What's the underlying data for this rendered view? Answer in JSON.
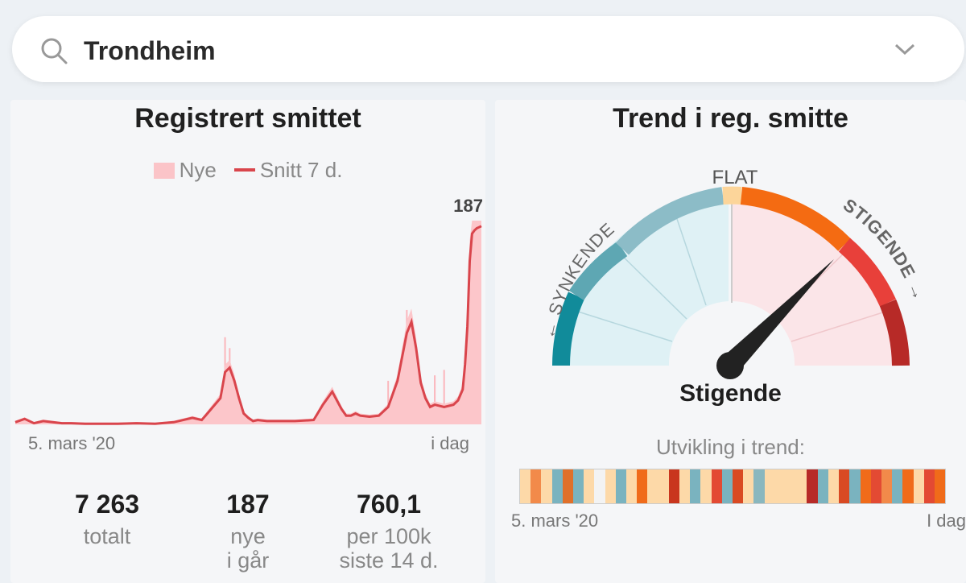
{
  "search": {
    "value": "Trondheim",
    "icon": "search-icon",
    "dropdown_icon": "chevron-down-icon"
  },
  "cases_card": {
    "title": "Registrert smittet",
    "legend": {
      "new_label": "Nye",
      "avg_label": "Snitt 7 d."
    },
    "peak_label": "187",
    "x_start": "5. mars '20",
    "x_end": "i dag",
    "stats": [
      {
        "value": "7 263",
        "label1": "totalt",
        "label2": ""
      },
      {
        "value": "187",
        "label1": "nye",
        "label2": "i går"
      },
      {
        "value": "760,1",
        "label1": "per 100k",
        "label2": "siste 14 d."
      }
    ]
  },
  "chart_data": {
    "type": "area",
    "title": "Registrert smittet",
    "xlabel": "",
    "ylabel": "",
    "x_range": [
      "5. mars '20",
      "i dag"
    ],
    "ylim": [
      0,
      187
    ],
    "legend": [
      "Nye",
      "Snitt 7 d."
    ],
    "annotation": "187",
    "series": [
      {
        "name": "Snitt 7 d.",
        "x_fraction": [
          0,
          0.02,
          0.04,
          0.06,
          0.08,
          0.1,
          0.12,
          0.15,
          0.18,
          0.22,
          0.26,
          0.3,
          0.34,
          0.38,
          0.4,
          0.42,
          0.44,
          0.45,
          0.46,
          0.47,
          0.48,
          0.49,
          0.5,
          0.51,
          0.52,
          0.54,
          0.56,
          0.6,
          0.64,
          0.66,
          0.68,
          0.7,
          0.71,
          0.72,
          0.73,
          0.74,
          0.76,
          0.78,
          0.8,
          0.82,
          0.84,
          0.85,
          0.86,
          0.87,
          0.88,
          0.89,
          0.9,
          0.92,
          0.94,
          0.95,
          0.96,
          0.965,
          0.97,
          0.975,
          0.98,
          0.985,
          0.99,
          1.0
        ],
        "values": [
          2,
          5,
          1,
          3,
          2,
          1,
          1,
          0.5,
          0.5,
          0.5,
          1,
          0.5,
          2,
          6,
          4,
          14,
          24,
          48,
          52,
          40,
          24,
          10,
          6,
          3,
          4,
          3,
          3,
          3,
          4,
          18,
          30,
          14,
          8,
          8,
          10,
          8,
          7,
          8,
          16,
          40,
          84,
          94,
          70,
          38,
          24,
          16,
          18,
          16,
          18,
          22,
          32,
          55,
          90,
          150,
          175,
          178,
          180,
          182
        ]
      }
    ],
    "peak_value": 187
  },
  "trend_card": {
    "title": "Trend i reg. smitte",
    "gauge_labels": {
      "left": "← SYNKENDE",
      "top": "FLAT",
      "right": "STIGENDE →"
    },
    "status": "Stigende",
    "strip_title": "Utvikling i trend:",
    "strip_start": "5. mars '20",
    "strip_end": "I dag",
    "strip_colors": [
      "#fdd9a8",
      "#f28a4a",
      "#fdd9a8",
      "#7ab3bf",
      "#e0702a",
      "#7ab3bf",
      "#fdd9a8",
      "#f3f3f3",
      "#fdd9a8",
      "#7ab3bf",
      "#fdd9a8",
      "#f06b1a",
      "#fdd9a8",
      "#fdd9a8",
      "#c9361e",
      "#fdd9a8",
      "#7ab3bf",
      "#fdd9a8",
      "#e34a33",
      "#7ab3bf",
      "#d94a23",
      "#fdd9a8",
      "#8ab7be",
      "#fdd9a8",
      "#fdd9a8",
      "#fdd9a8",
      "#fdd9a8",
      "#b72a27",
      "#7ab3bf",
      "#fdd9a8",
      "#d94a23",
      "#7ab3bf",
      "#f06b1a",
      "#e34a33",
      "#f28a4a",
      "#7ab3bf",
      "#f06b1a",
      "#fdd9a8",
      "#e34a33",
      "#f06b1a"
    ],
    "colors": {
      "teal_dark": "#118b9a",
      "teal_mid": "#5ea7b3",
      "teal_light": "#8cbcc7",
      "flat": "#fcd59a",
      "orange": "#f46b12",
      "red": "#e8403a",
      "dark_red": "#b72a27",
      "fill_left": "#dff1f5",
      "fill_right": "#fbe5e8",
      "needle": "#222222"
    },
    "needle_value": 0.78
  }
}
